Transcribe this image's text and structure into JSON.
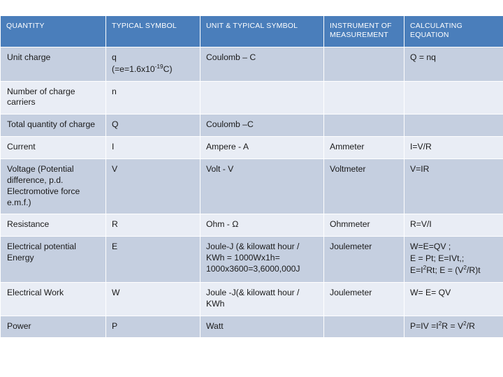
{
  "table": {
    "headers": [
      "QUANTITY",
      "TYPICAL SYMBOL",
      "UNIT & TYPICAL SYMBOL",
      "INSTRUMENT OF MEASUREMENT",
      "CALCULATING EQUATION"
    ],
    "colors": {
      "header_background": "#4A7EBB",
      "header_text": "#FFFFFF",
      "row_dark": "#C5CFE0",
      "row_light": "#E9EDF5",
      "body_text": "#1A1A1A",
      "page_background": "#FFFFFF"
    },
    "rows": [
      {
        "quantity": "Unit charge",
        "symbol_line1": "q",
        "symbol_line2_a": "(=e=1.6x10",
        "symbol_line2_sup": "-19",
        "symbol_line2_b": "C)",
        "unit": "Coulomb – C",
        "instrument": "",
        "equation": "Q = nq"
      },
      {
        "quantity": "Number of charge carriers",
        "symbol_line1": "n",
        "symbol_line2_a": "",
        "symbol_line2_sup": "",
        "symbol_line2_b": "",
        "unit": "",
        "instrument": "",
        "equation": ""
      },
      {
        "quantity": "Total quantity of charge",
        "symbol_line1": "Q",
        "symbol_line2_a": "",
        "symbol_line2_sup": "",
        "symbol_line2_b": "",
        "unit": "Coulomb –C",
        "instrument": "",
        "equation": ""
      },
      {
        "quantity": "Current",
        "symbol_line1": "I",
        "symbol_line2_a": "",
        "symbol_line2_sup": "",
        "symbol_line2_b": "",
        "unit": "Ampere - A",
        "instrument": "Ammeter",
        "equation": "I=V/R"
      },
      {
        "quantity": "Voltage (Potential difference, p.d. Electromotive force e.m.f.)",
        "symbol_line1": "V",
        "symbol_line2_a": "",
        "symbol_line2_sup": "",
        "symbol_line2_b": "",
        "unit": "Volt - V",
        "instrument": "Voltmeter",
        "equation": "V=IR"
      },
      {
        "quantity": "Resistance",
        "symbol_line1": "R",
        "symbol_line2_a": "",
        "symbol_line2_sup": "",
        "symbol_line2_b": "",
        "unit": "Ohm - Ω",
        "instrument": "Ohmmeter",
        "equation": "R=V/I"
      },
      {
        "quantity": "Electrical potential Energy",
        "symbol_line1": "E",
        "symbol_line2_a": "",
        "symbol_line2_sup": "",
        "symbol_line2_b": "",
        "unit": "Joule-J (& kilowatt hour / KWh = 1000Wx1h= 1000x3600=3,6000,000J",
        "instrument": "Joulemeter",
        "equation": "W=E=QV ;"
      },
      {
        "quantity": "Electrical Work",
        "symbol_line1": "W",
        "symbol_line2_a": "",
        "symbol_line2_sup": "",
        "symbol_line2_b": "",
        "unit": "Joule -J(& kilowatt hour / KWh",
        "instrument": "Joulemeter",
        "equation": "W= E= QV"
      },
      {
        "quantity": "Power",
        "symbol_line1": "P",
        "symbol_line2_a": "",
        "symbol_line2_sup": "",
        "symbol_line2_b": "",
        "unit": "Watt",
        "instrument": "",
        "equation_p_a": "P=IV =I",
        "equation_p_sup1": "2",
        "equation_p_b": "R = V",
        "equation_p_sup2": "2",
        "equation_p_c": "/R"
      }
    ],
    "energy_equation": {
      "line1": "W=E=QV ;",
      "line2": "E = Pt; E=IVt,;",
      "line3_a": "E=I",
      "line3_sup1": "2",
      "line3_b": "Rt; E = (V",
      "line3_sup2": "2",
      "line3_c": "/R)t"
    }
  }
}
